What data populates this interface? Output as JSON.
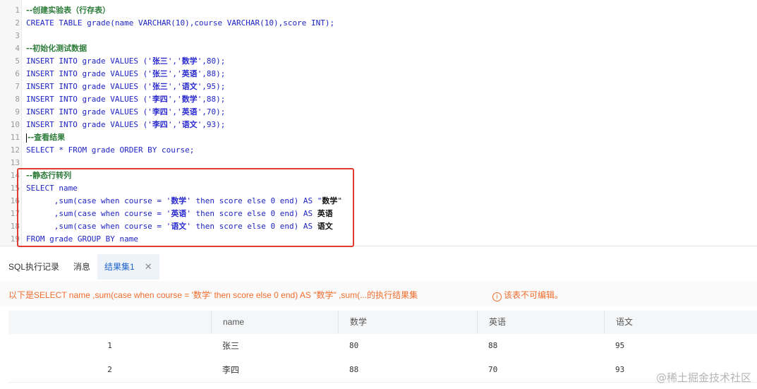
{
  "editor": {
    "lines": [
      {
        "n": "1"
      },
      {
        "n": "2"
      },
      {
        "n": "3"
      },
      {
        "n": "4"
      },
      {
        "n": "5"
      },
      {
        "n": "6"
      },
      {
        "n": "7"
      },
      {
        "n": "8"
      },
      {
        "n": "9"
      },
      {
        "n": "10"
      },
      {
        "n": "11"
      },
      {
        "n": "12"
      },
      {
        "n": "13"
      },
      {
        "n": "14"
      },
      {
        "n": "15"
      },
      {
        "n": "16"
      },
      {
        "n": "17"
      },
      {
        "n": "18"
      },
      {
        "n": "19"
      }
    ],
    "l1": "--创建实验表（行存表）",
    "l2": "CREATE TABLE grade(name VARCHAR(10),course VARCHAR(10),score INT);",
    "l4": "--初始化测试数据",
    "inserts": [
      {
        "pre": "INSERT INTO grade VALUES ('",
        "a": "张三",
        "mid": "','",
        "b": "数学",
        "post": "',80);"
      },
      {
        "pre": "INSERT INTO grade VALUES ('",
        "a": "张三",
        "mid": "','",
        "b": "英语",
        "post": "',88);"
      },
      {
        "pre": "INSERT INTO grade VALUES ('",
        "a": "张三",
        "mid": "','",
        "b": "语文",
        "post": "',95);"
      },
      {
        "pre": "INSERT INTO grade VALUES ('",
        "a": "李四",
        "mid": "','",
        "b": "数学",
        "post": "',88);"
      },
      {
        "pre": "INSERT INTO grade VALUES ('",
        "a": "李四",
        "mid": "','",
        "b": "英语",
        "post": "',70);"
      },
      {
        "pre": "INSERT INTO grade VALUES ('",
        "a": "李四",
        "mid": "','",
        "b": "语文",
        "post": "',93);"
      }
    ],
    "l11": "--查看结果",
    "l12": "SELECT * FROM grade ORDER BY course;",
    "l14": "--静态行转列",
    "l15": "SELECT name",
    "l16": {
      "pre": "      ,sum(case when course = '",
      "zh": "数学",
      "post": "' then score else 0 end) AS \"",
      "alias": "数学",
      "end": "\""
    },
    "l17": {
      "pre": "      ,sum(case when course = '",
      "zh": "英语",
      "post": "' then score else 0 end) AS ",
      "alias": "英语"
    },
    "l18": {
      "pre": "      ,sum(case when course = '",
      "zh": "语文",
      "post": "' then score else 0 end) AS ",
      "alias": "语文"
    },
    "l19": "FROM grade GROUP BY name"
  },
  "tabs": {
    "history": "SQL执行记录",
    "messages": "消息",
    "result": "结果集1",
    "close": "✕"
  },
  "notice": {
    "text": "以下是SELECT name ,sum(case when course = '数学' then score else 0 end) AS \"数学\" ,sum(...的执行结果集",
    "warn": "该表不可编辑。",
    "warn_icon": "i"
  },
  "table": {
    "headers": [
      "",
      "name",
      "数学",
      "英语",
      "语文"
    ],
    "rows": [
      [
        "1",
        "张三",
        "80",
        "88",
        "95"
      ],
      [
        "2",
        "李四",
        "88",
        "70",
        "93"
      ]
    ]
  },
  "watermark": "@稀土掘金技术社区"
}
